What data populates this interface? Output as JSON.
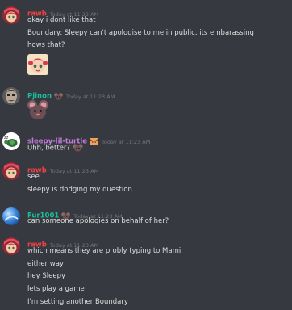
{
  "colors": {
    "background": "#36393f",
    "text": "#dcddde",
    "timestamp": "#72767d",
    "rawb": "#ed4245",
    "pjinon": "#1abc9c",
    "turtle": "#c27cd9",
    "fur": "#1abc9c"
  },
  "messages": [
    {
      "author": "rawb",
      "timestamp": "Today at 11:22 AM",
      "avatar_icon": "rawb-avatar",
      "lines": [
        "okay i dont like that",
        "Boundary: Sleepy can't apologise to me in public. its embarassing",
        "hows that?"
      ],
      "emoji": "anime-face-emoji"
    },
    {
      "author": "Pjinon",
      "timestamp": "Today at 11:23 AM",
      "avatar_icon": "pjinon-avatar",
      "badge_icon": "mouse-face-badge",
      "emoji": "mouse-face-emoji"
    },
    {
      "author": "sleepy-lil-turtle",
      "timestamp": "Today at 11:23 AM",
      "avatar_icon": "turtle-avatar",
      "badge_icon": "cat-face-badge",
      "lines": [
        "Uhh, better?"
      ],
      "inline_icon": "mouse-face-small-emoji"
    },
    {
      "author": "rawb",
      "timestamp": "Today at 11:23 AM",
      "avatar_icon": "rawb-avatar",
      "lines": [
        "see",
        "sleepy is dodging my question"
      ]
    },
    {
      "author": "Fur1001",
      "timestamp": "Today at 11:23 AM",
      "avatar_icon": "fur-avatar",
      "badge_icon": "mouse-face-badge",
      "lines": [
        "can someone apologies on behalf of her?"
      ]
    },
    {
      "author": "rawb",
      "timestamp": "Today at 11:23 AM",
      "avatar_icon": "rawb-avatar",
      "lines": [
        "which means they are probly typing to Mami",
        "either way",
        "hey Sleepy",
        "lets play a game",
        "I'm setting another Boundary"
      ]
    }
  ]
}
